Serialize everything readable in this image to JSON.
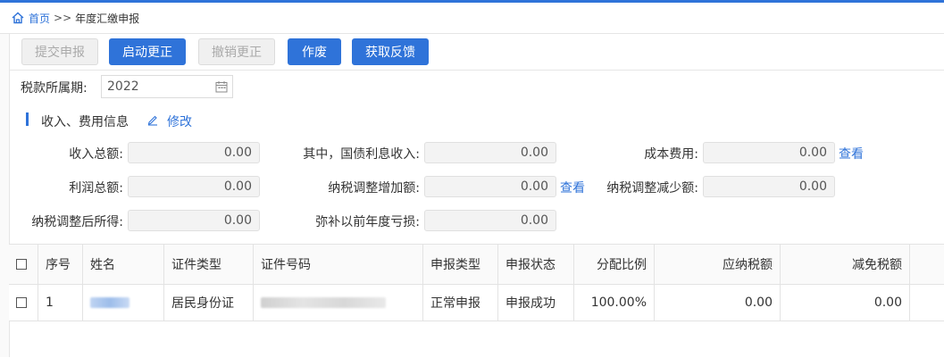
{
  "breadcrumb": {
    "home": "首页",
    "separator": ">>",
    "current": "年度汇缴申报"
  },
  "toolbar": {
    "submit": "提交申报",
    "start_correction": "启动更正",
    "cancel_correction": "撤销更正",
    "void": "作废",
    "get_feedback": "获取反馈"
  },
  "period": {
    "label": "税款所属期:",
    "value": "2022"
  },
  "section": {
    "title": "收入、费用信息",
    "edit": "修改"
  },
  "fields": {
    "total_income": {
      "label": "收入总额:",
      "value": "0.00"
    },
    "bond_interest": {
      "label": "其中，国债利息收入:",
      "value": "0.00"
    },
    "cost": {
      "label": "成本费用:",
      "value": "0.00",
      "link": "查看"
    },
    "total_profit": {
      "label": "利润总额:",
      "value": "0.00"
    },
    "adjust_increase": {
      "label": "纳税调整增加额:",
      "value": "0.00",
      "link": "查看"
    },
    "adjust_decrease": {
      "label": "纳税调整减少额:",
      "value": "0.00"
    },
    "adjusted_income": {
      "label": "纳税调整后所得:",
      "value": "0.00"
    },
    "prior_loss": {
      "label": "弥补以前年度亏损:",
      "value": "0.00"
    }
  },
  "table": {
    "headers": [
      "序号",
      "姓名",
      "证件类型",
      "证件号码",
      "申报类型",
      "申报状态",
      "分配比例",
      "应纳税额",
      "减免税额"
    ],
    "rows": [
      {
        "index": "1",
        "id_type": "居民身份证",
        "declare_type": "正常申报",
        "status": "申报成功",
        "ratio": "100.00%",
        "tax_payable": "0.00",
        "tax_relief": "0.00"
      }
    ]
  },
  "colors": {
    "accent": "#2f73d9"
  }
}
